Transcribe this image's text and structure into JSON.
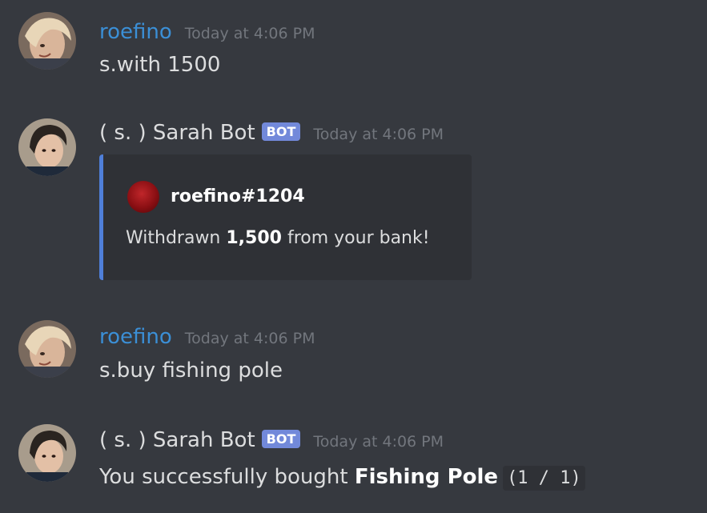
{
  "messages": [
    {
      "author": "roefino",
      "timestamp": "Today at 4:06 PM",
      "content": "s.with 1500"
    },
    {
      "author": "( s. ) Sarah Bot",
      "badge": "BOT",
      "timestamp": "Today at 4:06 PM",
      "embed": {
        "author_name": "roefino#1204",
        "desc_pre": "Withdrawn ",
        "desc_bold": "1,500",
        "desc_post": " from your bank!",
        "accent_color": "#4f7fd9"
      }
    },
    {
      "author": "roefino",
      "timestamp": "Today at 4:06 PM",
      "content": "s.buy fishing pole"
    },
    {
      "author": "( s. ) Sarah Bot",
      "badge": "BOT",
      "timestamp": "Today at 4:06 PM",
      "content_pre": "You successfully bought ",
      "content_bold": "Fishing Pole",
      "content_code": "(1 / 1)"
    }
  ],
  "colors": {
    "background": "#36393f",
    "user_name": "#3b8fd6",
    "bot_badge": "#7289da",
    "timestamp": "#72767d",
    "text": "#dcddde"
  },
  "icons": {
    "user_avatar": "user-avatar-icon",
    "bot_avatar": "bot-avatar-icon",
    "embed_author_icon": "embed-author-icon"
  }
}
